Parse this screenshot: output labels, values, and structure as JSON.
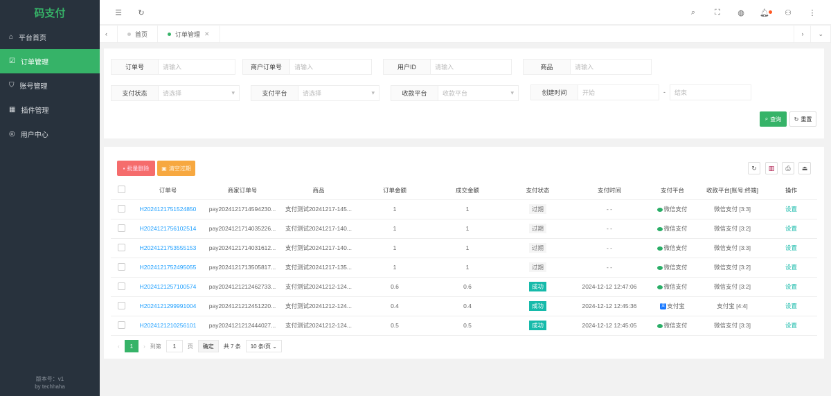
{
  "app": {
    "title": "码支付",
    "version": "版本号：v1",
    "author": "by techhaha"
  },
  "sidebar": {
    "items": [
      {
        "label": "平台首页",
        "icon": "home-icon"
      },
      {
        "label": "订单管理",
        "icon": "order-icon"
      },
      {
        "label": "账号管理",
        "icon": "shield-icon"
      },
      {
        "label": "插件管理",
        "icon": "grid-icon"
      },
      {
        "label": "用户中心",
        "icon": "user-icon"
      }
    ]
  },
  "tabs": [
    {
      "label": "首页"
    },
    {
      "label": "订单管理"
    }
  ],
  "filters": {
    "order_no": {
      "label": "订单号",
      "placeholder": "请输入"
    },
    "merchant_order_no": {
      "label": "商户订单号",
      "placeholder": "请输入"
    },
    "user_id": {
      "label": "用户ID",
      "placeholder": "请输入"
    },
    "product": {
      "label": "商品",
      "placeholder": "请输入"
    },
    "pay_status": {
      "label": "支付状态",
      "placeholder": "请选择"
    },
    "pay_platform": {
      "label": "支付平台",
      "placeholder": "请选择"
    },
    "receive_platform": {
      "label": "收款平台",
      "placeholder": "收款平台"
    },
    "created_time": {
      "label": "创建时间",
      "start": "开始",
      "sep": "-",
      "end": "结束"
    },
    "search": "查询",
    "reset": "重置"
  },
  "toolbar": {
    "batch_delete": "批量删除",
    "clear_expired": "清空过期"
  },
  "table": {
    "headers": [
      "订单号",
      "商家订单号",
      "商品",
      "订单金额",
      "成交金额",
      "支付状态",
      "支付时间",
      "支付平台",
      "收款平台[账号:终端]",
      "操作"
    ],
    "rows": [
      {
        "order_no": "H2024121751524850",
        "merchant_no": "pay2024121714594230...",
        "product": "支付测试20241217-145...",
        "amount": "1",
        "paid": "1",
        "status": "过期",
        "ok": false,
        "time": "- -",
        "platform": "微信支付",
        "ali": false,
        "receiver": "微信支付 [3:3]",
        "action": "设置"
      },
      {
        "order_no": "H2024121756102514",
        "merchant_no": "pay2024121714035226...",
        "product": "支付测试20241217-140...",
        "amount": "1",
        "paid": "1",
        "status": "过期",
        "ok": false,
        "time": "- -",
        "platform": "微信支付",
        "ali": false,
        "receiver": "微信支付 [3:2]",
        "action": "设置"
      },
      {
        "order_no": "H2024121753555153",
        "merchant_no": "pay2024121714031612...",
        "product": "支付测试20241217-140...",
        "amount": "1",
        "paid": "1",
        "status": "过期",
        "ok": false,
        "time": "- -",
        "platform": "微信支付",
        "ali": false,
        "receiver": "微信支付 [3:3]",
        "action": "设置"
      },
      {
        "order_no": "H2024121752495055",
        "merchant_no": "pay2024121713505817...",
        "product": "支付测试20241217-135...",
        "amount": "1",
        "paid": "1",
        "status": "过期",
        "ok": false,
        "time": "- -",
        "platform": "微信支付",
        "ali": false,
        "receiver": "微信支付 [3:2]",
        "action": "设置"
      },
      {
        "order_no": "H2024121257100574",
        "merchant_no": "pay2024121212462733...",
        "product": "支付测试20241212-124...",
        "amount": "0.6",
        "paid": "0.6",
        "status": "成功",
        "ok": true,
        "time": "2024-12-12 12:47:06",
        "platform": "微信支付",
        "ali": false,
        "receiver": "微信支付 [3:2]",
        "action": "设置"
      },
      {
        "order_no": "H2024121299991004",
        "merchant_no": "pay2024121212451220...",
        "product": "支付测试20241212-124...",
        "amount": "0.4",
        "paid": "0.4",
        "status": "成功",
        "ok": true,
        "time": "2024-12-12 12:45:36",
        "platform": "支付宝",
        "ali": true,
        "receiver": "支付宝 [4:4]",
        "action": "设置"
      },
      {
        "order_no": "H2024121210256101",
        "merchant_no": "pay2024121212444027...",
        "product": "支付测试20241212-124...",
        "amount": "0.5",
        "paid": "0.5",
        "status": "成功",
        "ok": true,
        "time": "2024-12-12 12:45:05",
        "platform": "微信支付",
        "ali": false,
        "receiver": "微信支付 [3:3]",
        "action": "设置"
      }
    ]
  },
  "pagination": {
    "current": "1",
    "goto_label": "到第",
    "goto_value": "1",
    "page_unit": "页",
    "confirm": "确定",
    "total": "共 7 条",
    "page_size": "10 条/页"
  },
  "colors": {
    "accent": "#36b368",
    "sidebar": "#28323d",
    "danger": "#f56c6c",
    "warning": "#f7a840",
    "link": "#1e9fff",
    "teal": "#16baaa"
  }
}
